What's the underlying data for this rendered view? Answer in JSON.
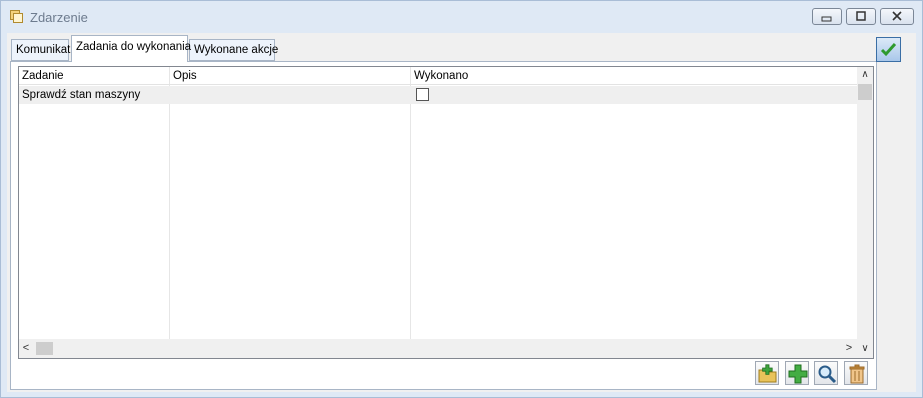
{
  "window": {
    "title": "Zdarzenie",
    "controls": {
      "minimize": "minimize-icon",
      "maximize": "maximize-icon",
      "close": "close-icon"
    }
  },
  "tabs": [
    {
      "label": "Komunikat",
      "active": false
    },
    {
      "label": "Zadania do wykonania",
      "active": true
    },
    {
      "label": "Wykonane akcje",
      "active": false
    }
  ],
  "grid": {
    "columns": [
      "Zadanie",
      "Opis",
      "Wykonano"
    ],
    "rows": [
      {
        "zadanie": "Sprawdź stan maszyny",
        "opis": "",
        "wykonano": false
      }
    ]
  },
  "toolbar": {
    "buttons": [
      "add-folder-icon",
      "add-icon",
      "search-icon",
      "delete-icon"
    ]
  },
  "actions": {
    "confirm": "checkmark-icon"
  },
  "colors": {
    "accent": "#3a6ea5",
    "check_green": "#2e9a2e",
    "titlebar": "#dfe9f5"
  }
}
